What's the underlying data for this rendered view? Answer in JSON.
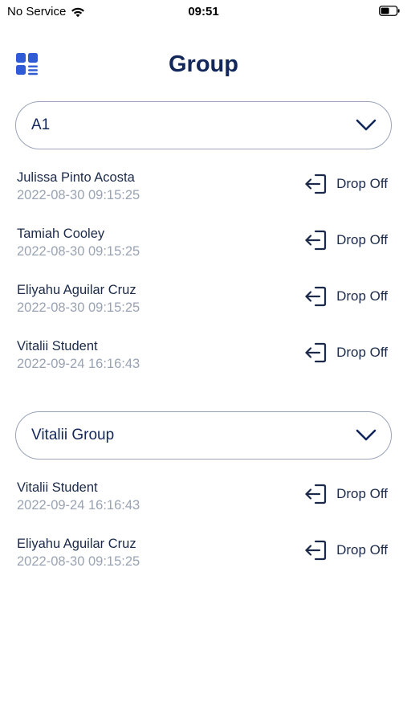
{
  "status_bar": {
    "carrier": "No Service",
    "time": "09:51",
    "wifi_icon": "wifi-icon",
    "battery_icon": "battery-icon"
  },
  "header": {
    "title": "Group",
    "menu_icon": "grid-menu-icon"
  },
  "groups": [
    {
      "name": "A1",
      "members": [
        {
          "name": "Julissa Pinto Acosta",
          "time": "2022-08-30 09:15:25",
          "action": "Drop Off"
        },
        {
          "name": "Tamiah Cooley",
          "time": "2022-08-30 09:15:25",
          "action": "Drop Off"
        },
        {
          "name": "Eliyahu Aguilar Cruz",
          "time": "2022-08-30 09:15:25",
          "action": "Drop Off"
        },
        {
          "name": "Vitalii Student",
          "time": "2022-09-24 16:16:43",
          "action": "Drop Off"
        }
      ]
    },
    {
      "name": "Vitalii Group",
      "members": [
        {
          "name": "Vitalii Student",
          "time": "2022-09-24 16:16:43",
          "action": "Drop Off"
        },
        {
          "name": "Eliyahu Aguilar Cruz",
          "time": "2022-08-30 09:15:25",
          "action": "Drop Off"
        }
      ]
    }
  ],
  "colors": {
    "title": "#13275a",
    "accent": "#2f5bd6",
    "muted": "#9aa3b3",
    "border": "#9aa3b8"
  }
}
